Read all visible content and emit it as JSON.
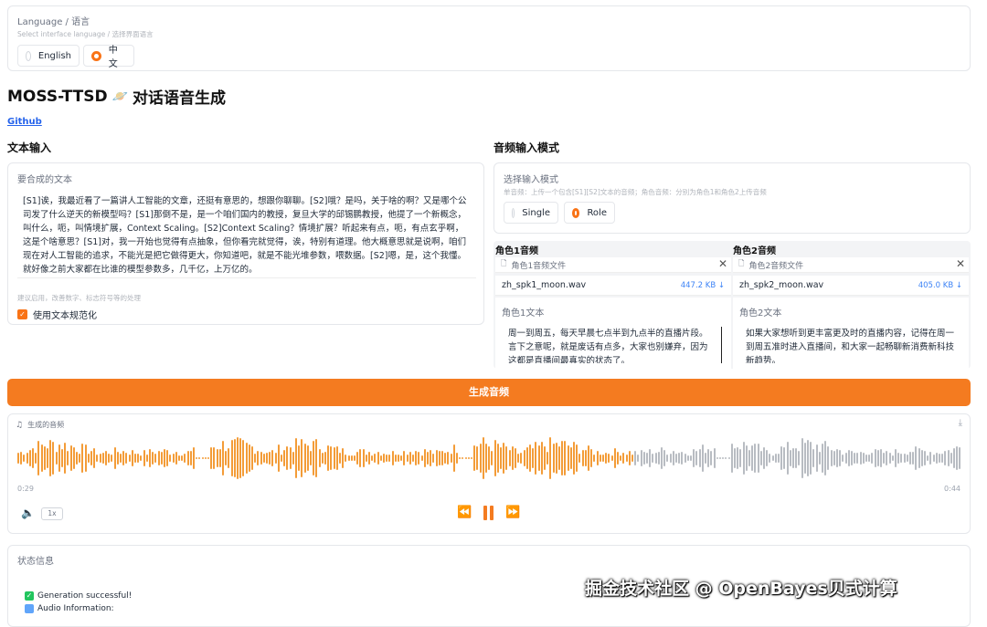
{
  "language": {
    "label": "Language / 语言",
    "hint": "Select interface language / 选择界面语言",
    "options": [
      "English",
      "中文"
    ],
    "selected": "中文"
  },
  "app": {
    "title": "MOSS-TTSD",
    "title_emoji": "🪐",
    "subtitle": "对话语音生成",
    "github_link": "Github"
  },
  "text_input": {
    "section_title": "文本输入",
    "field_label": "要合成的文本",
    "value": "[S1]诶，我最近看了一篇讲人工智能的文章，还挺有意思的，想跟你聊聊。[S2]哦？是吗，关于啥的啊？又是哪个公司发了什么逆天的新模型吗？[S1]那倒不是，是一个咱们国内的教授，复旦大学的邱锡鹏教授，他提了一个新概念，叫什么，呃，叫情境扩展，Context Scaling。[S2]Context Scaling？情境扩展？听起来有点，呃，有点玄乎啊，这是个啥意思？[S1]对，我一开始也觉得有点抽象，但你看完就觉得，诶，特别有道理。他大概意思就是说啊，咱们现在对人工智能的追求，不能光是把它做得更大，你知道吧，就是不能光堆参数，喂数据。[S2]嗯，是，这个我懂。就好像之前大家都在比谁的模型参数多，几千亿，上万亿的。",
    "normalize_hint": "建议启用，改善数字、标志符号等的处理",
    "normalize_label": "使用文本规范化",
    "normalize_checked": true
  },
  "audio_mode": {
    "section_title": "音频输入模式",
    "field_label": "选择输入模式",
    "hint": "单音频：上传一个包含[S1][S2]文本的音频；角色音频：分别为角色1和角色2上传音频",
    "options": [
      "Single",
      "Role"
    ],
    "selected": "Role"
  },
  "speakers": [
    {
      "header": "角色1音频",
      "file_label": "角色1音频文件",
      "file_name": "zh_spk1_moon.wav",
      "file_size": "447.2 KB ↓",
      "text_label": "角色1文本",
      "text_value": "周一到周五，每天早晨七点半到九点半的直播片段。言下之意呢，就是废话有点多，大家也别嫌弃，因为这都是直播间最真实的状态了。"
    },
    {
      "header": "角色2音频",
      "file_label": "角色2音频文件",
      "file_name": "zh_spk2_moon.wav",
      "file_size": "405.0 KB ↓",
      "text_label": "角色2文本",
      "text_value": "如果大家想听到更丰富更及时的直播内容，记得在周一到周五准时进入直播间，和大家一起畅聊新消费新科技新趋势。"
    }
  ],
  "generate_button": "生成音频",
  "player": {
    "label": "生成的音频",
    "time_current": "0:29",
    "time_total": "0:44",
    "progress": 0.655,
    "speed": "1x",
    "colors": {
      "played": "#f39c38",
      "unplayed": "#b8bcc2"
    }
  },
  "status": {
    "label": "状态信息",
    "line1": "Generation successful!",
    "line2": "Audio Information:"
  },
  "watermark": "掘金技术社区 @ OpenBayes贝式计算"
}
